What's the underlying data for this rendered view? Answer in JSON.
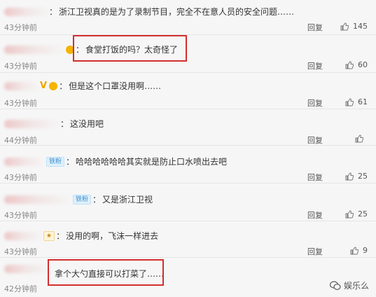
{
  "comments": [
    {
      "text": "浙江卫视真的是为了录制节目，完全不在意人员的安全问题……",
      "time": "43分钟前",
      "reply": "回复",
      "likes": "145",
      "badge": ""
    },
    {
      "text": "食堂打饭的吗？太奇怪了",
      "time": "43分钟前",
      "reply": "回复",
      "likes": "60",
      "badge": ""
    },
    {
      "text": "但是这个口罩没用啊……",
      "time": "43分钟前",
      "reply": "回复",
      "likes": "61",
      "badge": ""
    },
    {
      "text": "这没用吧",
      "time": "44分钟前",
      "reply": "回复",
      "likes": "",
      "badge": ""
    },
    {
      "text": "哈哈哈哈哈哈其实就是防止口水喷出去吧",
      "time": "43分钟前",
      "reply": "回复",
      "likes": "25",
      "badge": "铁粉"
    },
    {
      "text": "又是浙江卫视",
      "time": "43分钟前",
      "reply": "回复",
      "likes": "25",
      "badge": "铁粉"
    },
    {
      "text": "没用的啊，飞沫一样进去",
      "time": "43分钟前",
      "reply": "回复",
      "likes": "9",
      "badge": ""
    },
    {
      "text": "拿个大勺直接可以打菜了……",
      "time": "42分钟前",
      "reply": "",
      "likes": "",
      "badge": ""
    }
  ],
  "colon": "：",
  "watermark": {
    "label": "娱乐么",
    "icon": "wechat-icon"
  },
  "colors": {
    "highlight": "#d32f2f",
    "background": "#f6f6f6"
  }
}
